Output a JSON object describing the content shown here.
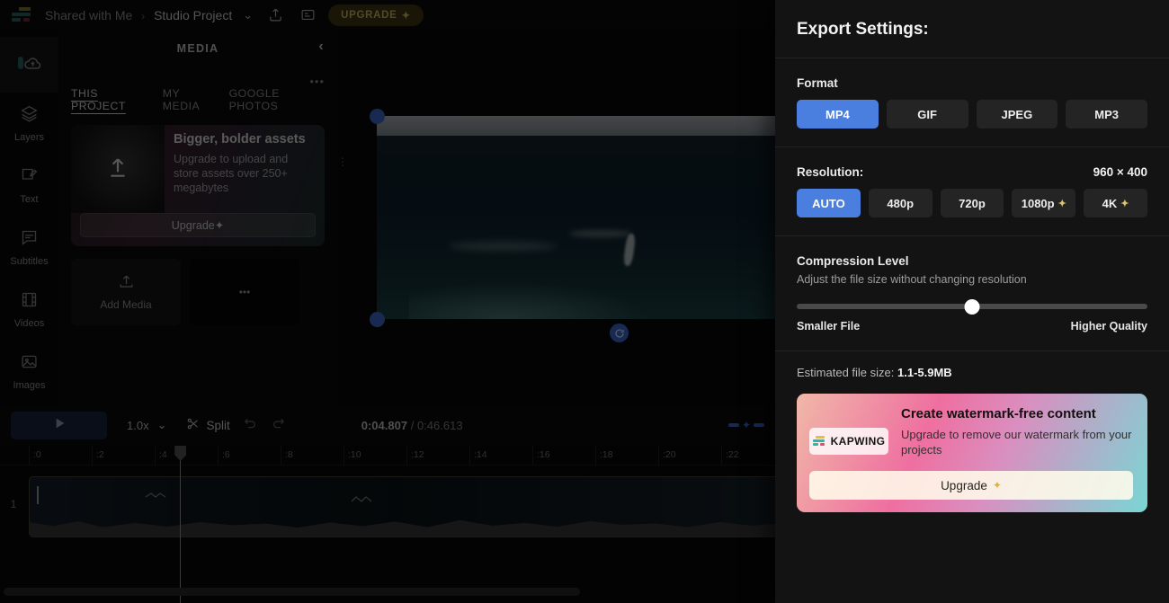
{
  "topbar": {
    "breadcrumb_root": "Shared with Me",
    "breadcrumb_sep": "›",
    "breadcrumb_current": "Studio Project",
    "dropdown_caret": "⌄",
    "upgrade_label": "UPGRADE",
    "upgrade_spark": "✦"
  },
  "rail": {
    "items": [
      {
        "label": "Layers",
        "icon": "layers-icon"
      },
      {
        "label": "Text",
        "icon": "text-icon"
      },
      {
        "label": "Subtitles",
        "icon": "subtitles-icon"
      },
      {
        "label": "Videos",
        "icon": "videos-icon"
      },
      {
        "label": "Images",
        "icon": "images-icon"
      }
    ]
  },
  "media": {
    "title": "MEDIA",
    "collapse_icon": "‹",
    "more_icon": "•••",
    "tabs": [
      {
        "label": "THIS PROJECT",
        "active": true
      },
      {
        "label": "MY MEDIA",
        "active": false
      },
      {
        "label": "GOOGLE PHOTOS",
        "active": false
      }
    ],
    "promo": {
      "heading": "Bigger, bolder assets",
      "body": "Upgrade to upload and store assets over 250+ megabytes",
      "button": "Upgrade",
      "button_spark": "✦"
    },
    "add_media_label": "Add Media",
    "thumb_placeholder": "•••"
  },
  "toolbar": {
    "play_label": "play-button",
    "speed_value": "1.0x",
    "speed_caret": "⌄",
    "split_label": "Split",
    "current_time": "0:04.807",
    "time_sep": "/",
    "total_time": "0:46.613"
  },
  "timeline": {
    "ticks": [
      ":0",
      ":2",
      ":4",
      ":6",
      ":8",
      ":10",
      ":12",
      ":14",
      ":16",
      ":18",
      ":20",
      ":22"
    ],
    "track_number": "1"
  },
  "export": {
    "title": "Export Settings:",
    "format_label": "Format",
    "formats": [
      {
        "label": "MP4",
        "selected": true
      },
      {
        "label": "GIF",
        "selected": false
      },
      {
        "label": "JPEG",
        "selected": false
      },
      {
        "label": "MP3",
        "selected": false
      }
    ],
    "resolution_label": "Resolution:",
    "resolution_value": "960 × 400",
    "resolutions": [
      {
        "label": "AUTO",
        "selected": true,
        "spark": ""
      },
      {
        "label": "480p",
        "selected": false,
        "spark": ""
      },
      {
        "label": "720p",
        "selected": false,
        "spark": ""
      },
      {
        "label": "1080p",
        "selected": false,
        "spark": "✦"
      },
      {
        "label": "4K",
        "selected": false,
        "spark": "✦"
      }
    ],
    "compression_label": "Compression Level",
    "compression_sub": "Adjust the file size without changing resolution",
    "slider_min_label": "Smaller File",
    "slider_max_label": "Higher Quality",
    "estimate_prefix": "Estimated file size:",
    "estimate_value": "1.1-5.9MB",
    "watermark": {
      "heading": "Create watermark-free content",
      "body": "Upgrade to remove our watermark from your projects",
      "brand": "KAPWING",
      "button": "Upgrade",
      "button_spark": "✦"
    }
  },
  "colors": {
    "accent_blue": "#4a7fe0",
    "upgrade_gold": "#d7c070",
    "panel_bg": "#131313"
  }
}
